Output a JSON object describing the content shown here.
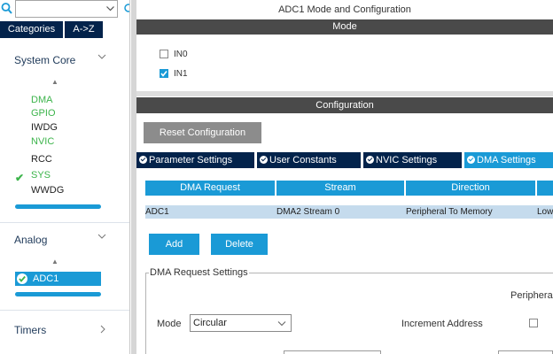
{
  "sidebar": {
    "search": {
      "value": "",
      "placeholder": ""
    },
    "tabs": [
      {
        "label": "Categories"
      },
      {
        "label": "A->Z"
      }
    ],
    "sections": [
      {
        "title": "System Core"
      },
      {
        "title": "Analog"
      },
      {
        "title": "Timers"
      }
    ],
    "system_core_items": [
      {
        "label": "DMA",
        "color": "#3cb44b"
      },
      {
        "label": "GPIO",
        "color": "#3cb44b"
      },
      {
        "label": "IWDG",
        "color": "#222222"
      },
      {
        "label": "NVIC",
        "color": "#3cb44b"
      },
      {
        "label": "RCC",
        "color": "#222222"
      },
      {
        "label": "SYS",
        "color": "#3cb44b"
      },
      {
        "label": "WWDG",
        "color": "#222222"
      }
    ],
    "analog_items": [
      {
        "label": "ADC1",
        "selected": true
      }
    ]
  },
  "main": {
    "title": "ADC1 Mode and Configuration",
    "mode_band": "Mode",
    "mode_options": [
      {
        "label": "IN0",
        "checked": false
      },
      {
        "label": "IN1",
        "checked": true
      }
    ],
    "config_band": "Configuration",
    "reset_button": "Reset Configuration",
    "tabs": [
      {
        "label": "Parameter Settings",
        "active": false
      },
      {
        "label": "User Constants",
        "active": false
      },
      {
        "label": "NVIC Settings",
        "active": false
      },
      {
        "label": "DMA Settings",
        "active": true
      }
    ],
    "table": {
      "headers": [
        "DMA Request",
        "Stream",
        "Direction",
        ""
      ],
      "rows": [
        [
          "ADC1",
          "DMA2 Stream 0",
          "Peripheral To Memory",
          "Low"
        ]
      ]
    },
    "add_button": "Add",
    "delete_button": "Delete",
    "request_settings": {
      "title": "DMA Request Settings",
      "peripheral_label": "Peripheral",
      "mode_label": "Mode",
      "mode_value": "Circular",
      "increment_label": "Increment Address",
      "increment_checked": false
    }
  },
  "colors": {
    "accent": "#1a9ad6",
    "dark": "#03234b",
    "band": "#4a4a4a",
    "green": "#3cb44b"
  }
}
